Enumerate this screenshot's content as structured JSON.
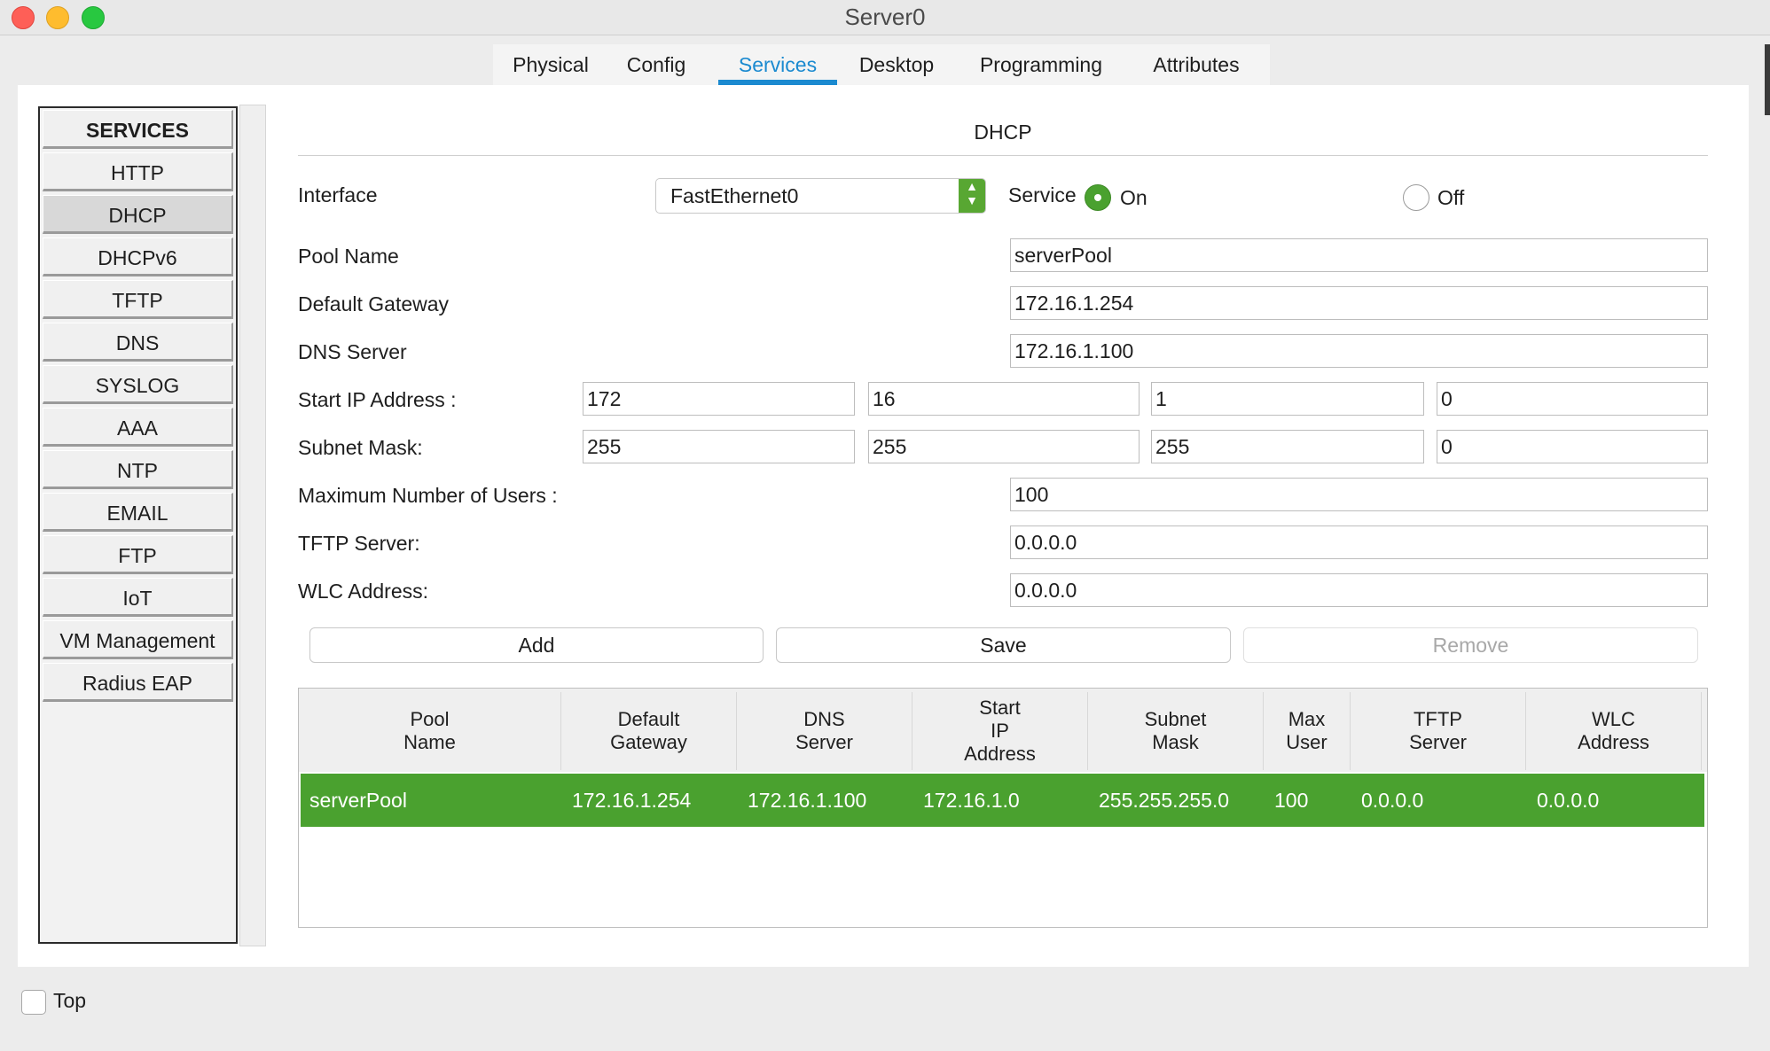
{
  "window": {
    "title": "Server0"
  },
  "tabs": [
    {
      "label": "Physical"
    },
    {
      "label": "Config"
    },
    {
      "label": "Services"
    },
    {
      "label": "Desktop"
    },
    {
      "label": "Programming"
    },
    {
      "label": "Attributes"
    }
  ],
  "active_tab": "Services",
  "sidebar": {
    "header": "SERVICES",
    "items": [
      {
        "label": "HTTP"
      },
      {
        "label": "DHCP"
      },
      {
        "label": "DHCPv6"
      },
      {
        "label": "TFTP"
      },
      {
        "label": "DNS"
      },
      {
        "label": "SYSLOG"
      },
      {
        "label": "AAA"
      },
      {
        "label": "NTP"
      },
      {
        "label": "EMAIL"
      },
      {
        "label": "FTP"
      },
      {
        "label": "IoT"
      },
      {
        "label": "VM Management"
      },
      {
        "label": "Radius EAP"
      }
    ],
    "selected": "DHCP"
  },
  "dhcp": {
    "title": "DHCP",
    "interface_label": "Interface",
    "interface_value": "FastEthernet0",
    "service_label": "Service",
    "service_on": "On",
    "service_off": "Off",
    "service_state": "On",
    "pool_name_label": "Pool Name",
    "pool_name": "serverPool",
    "gateway_label": "Default Gateway",
    "gateway": "172.16.1.254",
    "dns_label": "DNS Server",
    "dns": "172.16.1.100",
    "start_ip_label": "Start IP Address :",
    "start_ip": [
      "172",
      "16",
      "1",
      "0"
    ],
    "mask_label": "Subnet Mask:",
    "mask": [
      "255",
      "255",
      "255",
      "0"
    ],
    "max_users_label": "Maximum Number of Users :",
    "max_users": "100",
    "tftp_label": "TFTP Server:",
    "tftp": "0.0.0.0",
    "wlc_label": "WLC Address:",
    "wlc": "0.0.0.0",
    "buttons": {
      "add": "Add",
      "save": "Save",
      "remove": "Remove"
    }
  },
  "table": {
    "columns": [
      "Pool\nName",
      "Default\nGateway",
      "DNS\nServer",
      "Start\nIP\nAddress",
      "Subnet\nMask",
      "Max\nUser",
      "TFTP\nServer",
      "WLC\nAddress"
    ],
    "rows": [
      [
        "serverPool",
        "172.16.1.254",
        "172.16.1.100",
        "172.16.1.0",
        "255.255.255.0",
        "100",
        "0.0.0.0",
        "0.0.0.0"
      ]
    ]
  },
  "bottom": {
    "top_label": "Top"
  },
  "colors": {
    "accent": "#1b8ad0",
    "selected_row": "#4aa12f",
    "radio_on": "#4aa12f"
  }
}
